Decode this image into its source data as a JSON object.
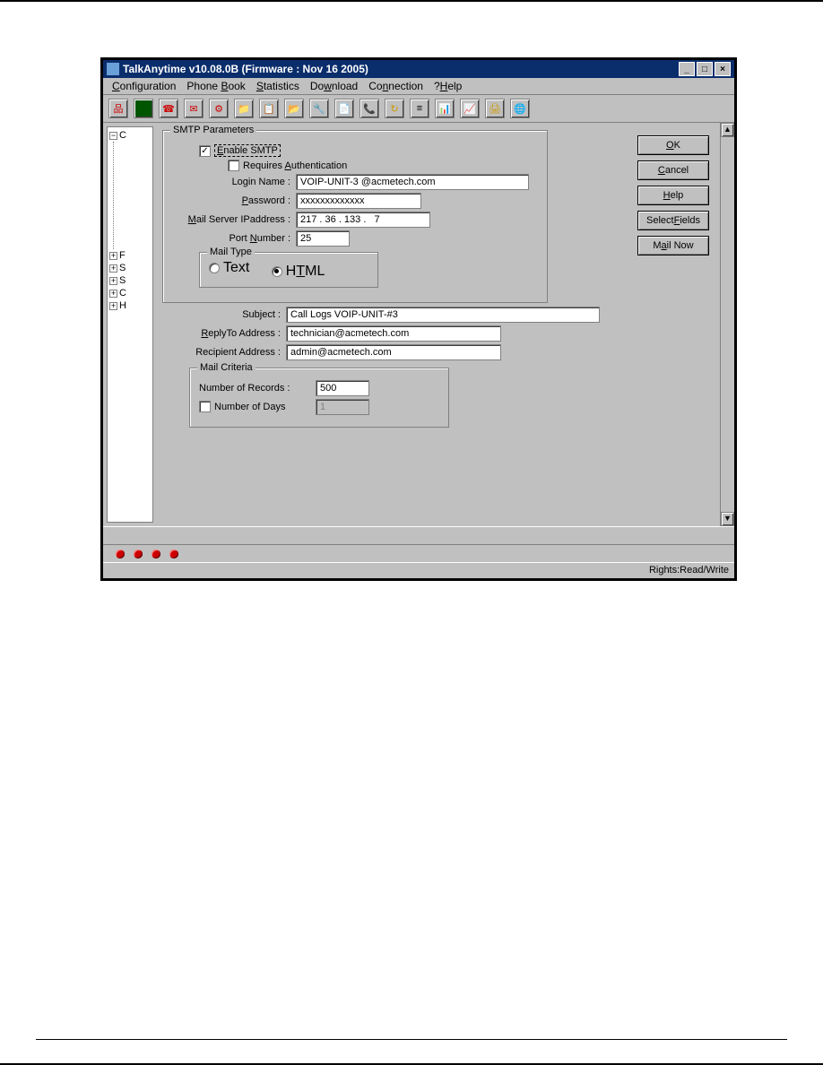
{
  "titlebar": {
    "text": "TalkAnytime v10.08.0B (Firmware : Nov 16 2005)"
  },
  "menubar": [
    "Configuration",
    "Phone Book",
    "Statistics",
    "Download",
    "Connection",
    "?Help"
  ],
  "smtp": {
    "group_label": "SMTP Parameters",
    "enable_label": "Enable SMTP",
    "enable_checked": true,
    "requires_auth_label": "Requires Authentication",
    "requires_auth_checked": false,
    "login_label": "Login Name :",
    "login_value": "VOIP-UNIT-3 @acmetech.com",
    "password_label": "Password :",
    "password_value": "xxxxxxxxxxxxx",
    "mailserver_label": "Mail Server IPaddress :",
    "mailserver_value": "217 . 36 . 133 .   7",
    "port_label": "Port Number :",
    "port_value": "25",
    "mailtype_label": "Mail Type",
    "mailtype_text": "Text",
    "mailtype_html": "HTML",
    "mailtype_selected": "HTML",
    "subject_label": "Subject :",
    "subject_value": "Call Logs VOIP-UNIT-#3",
    "replyto_label": "ReplyTo Address :",
    "replyto_value": "technician@acmetech.com",
    "recipient_label": "Recipient Address :",
    "recipient_value": "admin@acmetech.com",
    "mailcriteria_label": "Mail Criteria",
    "num_records_label": "Number of Records :",
    "num_records_value": "500",
    "num_days_label": "Number of Days",
    "num_days_checked": false,
    "num_days_value": "1"
  },
  "buttons": {
    "ok": "OK",
    "cancel": "Cancel",
    "help": "Help",
    "select_fields": "Select Fields",
    "mail_now": "Mail Now"
  },
  "status": {
    "rights": "Rights:Read/Write"
  },
  "tree": {
    "items": [
      "C",
      "F",
      "S",
      "S",
      "C",
      "H"
    ]
  }
}
